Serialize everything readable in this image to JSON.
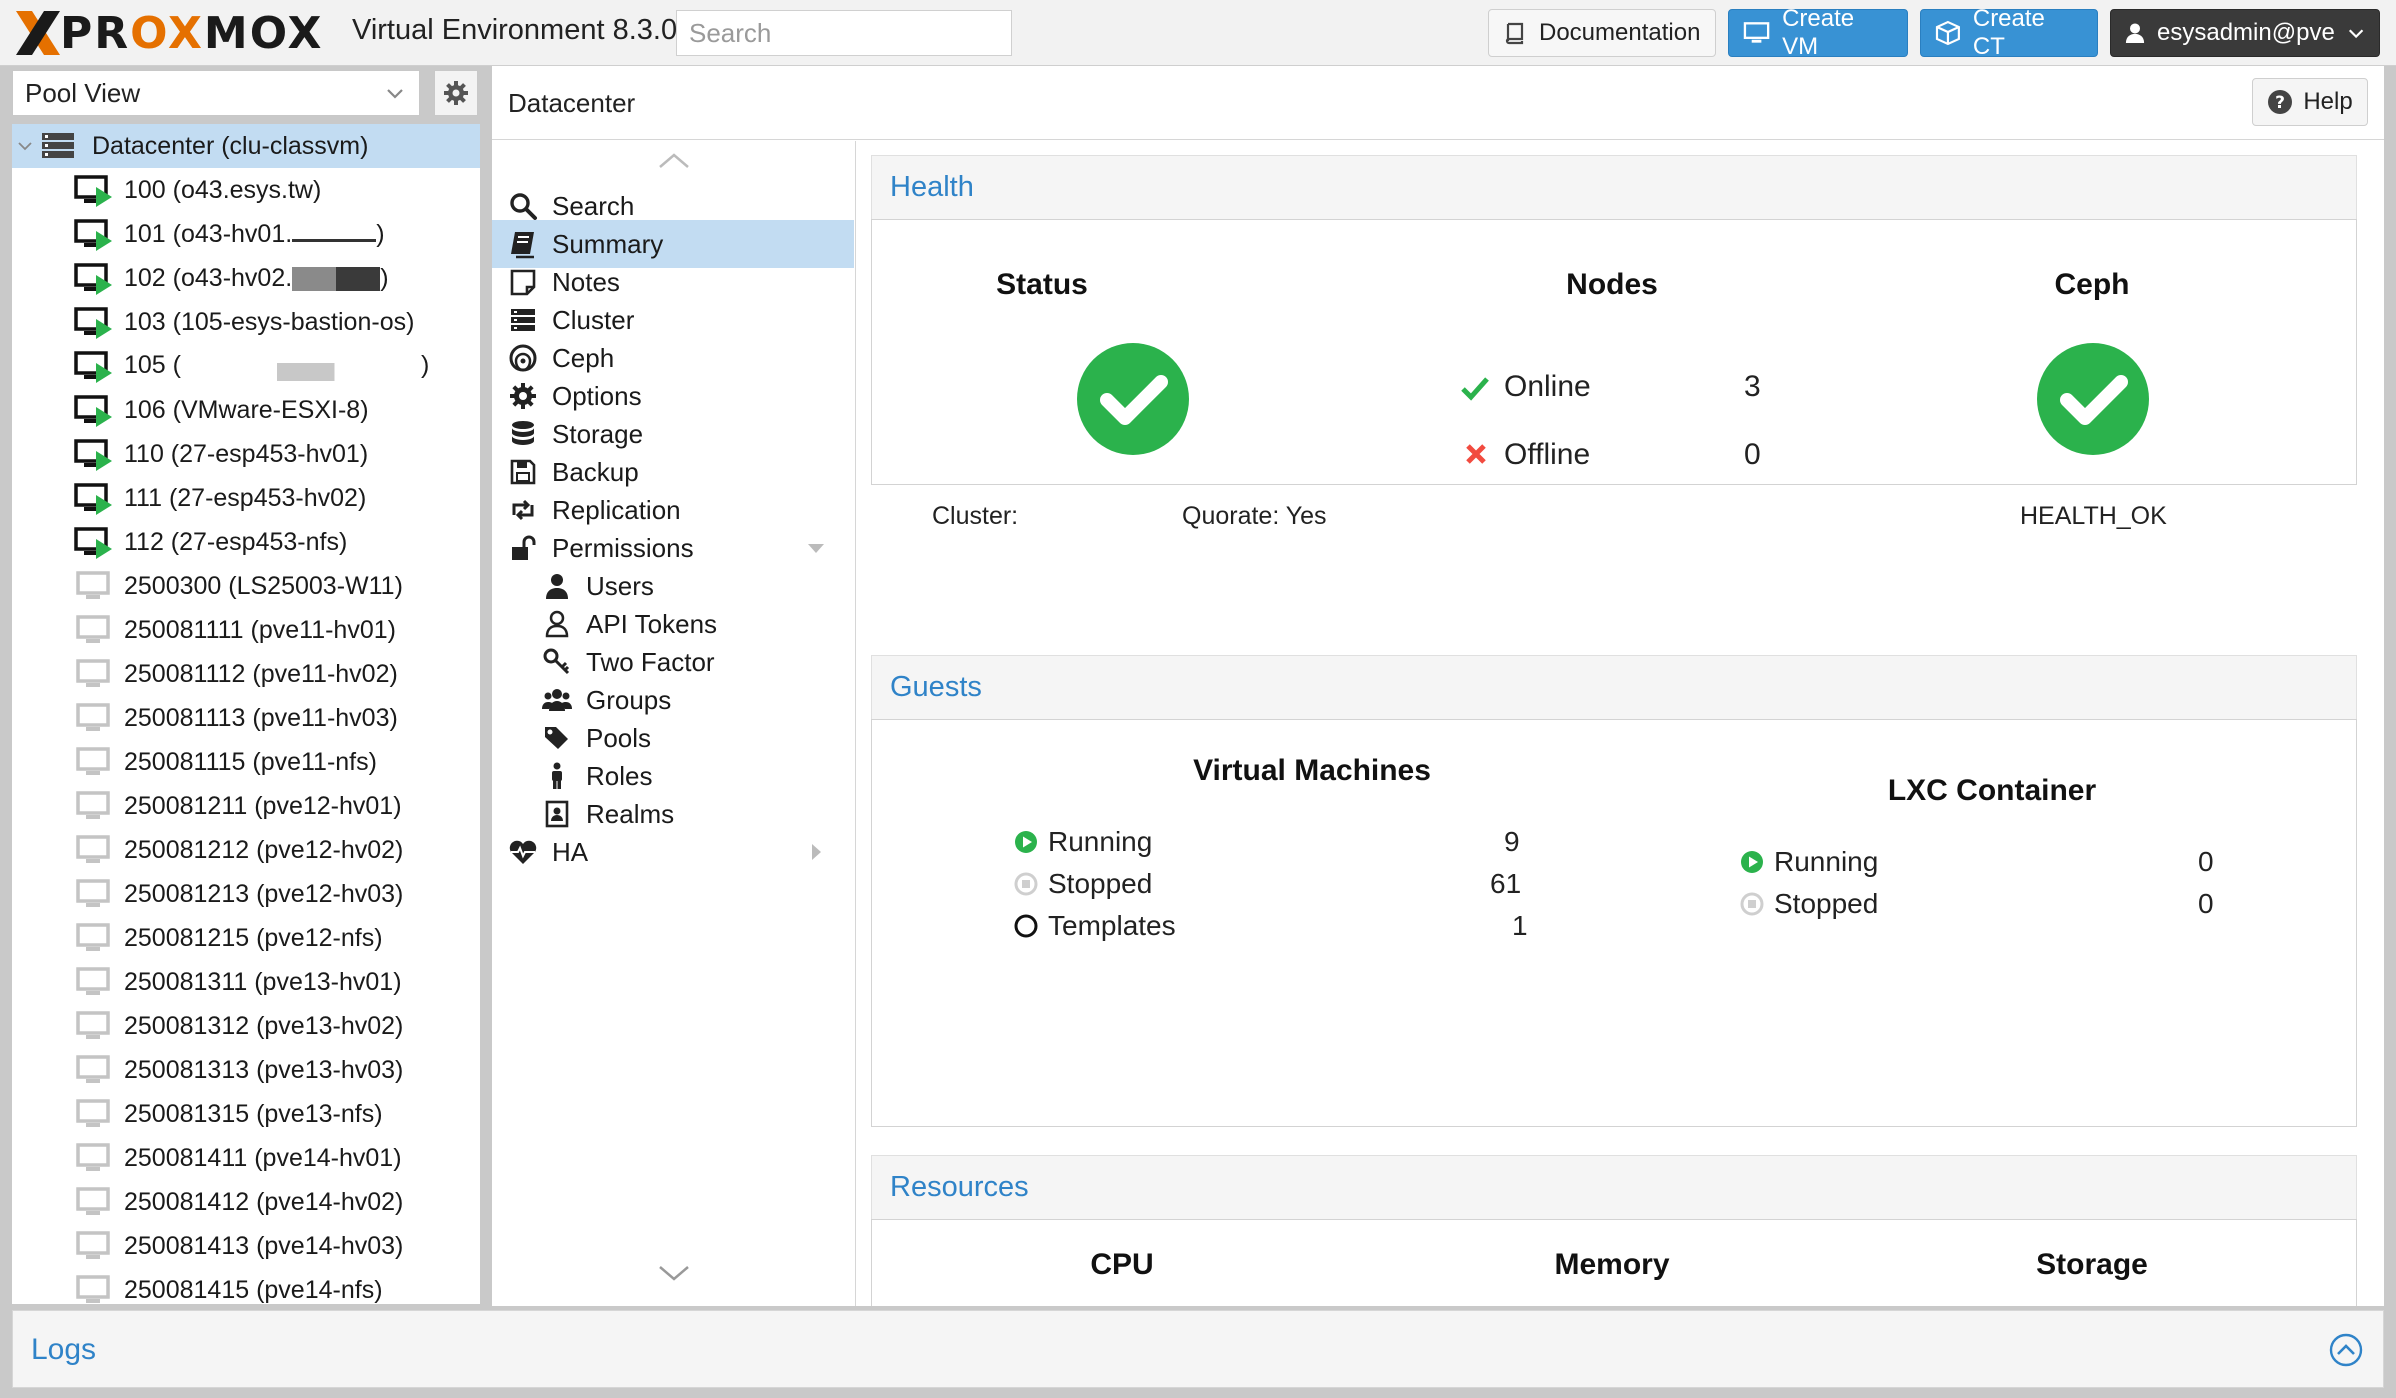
{
  "topbar": {
    "brand": "PROXMOX",
    "product": "Virtual Environment 8.3.0",
    "search_placeholder": "Search",
    "doc_label": "Documentation",
    "create_vm_label": "Create VM",
    "create_ct_label": "Create CT",
    "user_label": "esysadmin@pve",
    "accent_color": "#3892d4",
    "brand_color": "#e57000"
  },
  "tree": {
    "view_selected": "Pool View",
    "root": "Datacenter (clu-classvm)",
    "items": [
      {
        "prefix": "100 (o43.esys.tw)",
        "suffix": "",
        "running": true,
        "redact": ""
      },
      {
        "prefix": "101 (o43-hv01.",
        "suffix": ")",
        "running": true,
        "redact": "underline"
      },
      {
        "prefix": "102 (o43-hv02.",
        "suffix": ")",
        "running": true,
        "redact": "dark"
      },
      {
        "prefix": "103 (105-esys-bastion-os)",
        "suffix": "",
        "running": true,
        "redact": ""
      },
      {
        "prefix": "105 (",
        "suffix": ")",
        "running": true,
        "redact": "light"
      },
      {
        "prefix": "106 (VMware-ESXI-8)",
        "suffix": "",
        "running": true,
        "redact": ""
      },
      {
        "prefix": "110 (27-esp453-hv01)",
        "suffix": "",
        "running": true,
        "redact": ""
      },
      {
        "prefix": "111 (27-esp453-hv02)",
        "suffix": "",
        "running": true,
        "redact": ""
      },
      {
        "prefix": "112 (27-esp453-nfs)",
        "suffix": "",
        "running": true,
        "redact": ""
      },
      {
        "prefix": "2500300 (LS25003-W11)",
        "suffix": "",
        "running": false,
        "redact": ""
      },
      {
        "prefix": "250081111 (pve11-hv01)",
        "suffix": "",
        "running": false,
        "redact": ""
      },
      {
        "prefix": "250081112 (pve11-hv02)",
        "suffix": "",
        "running": false,
        "redact": ""
      },
      {
        "prefix": "250081113 (pve11-hv03)",
        "suffix": "",
        "running": false,
        "redact": ""
      },
      {
        "prefix": "250081115 (pve11-nfs)",
        "suffix": "",
        "running": false,
        "redact": ""
      },
      {
        "prefix": "250081211 (pve12-hv01)",
        "suffix": "",
        "running": false,
        "redact": ""
      },
      {
        "prefix": "250081212 (pve12-hv02)",
        "suffix": "",
        "running": false,
        "redact": ""
      },
      {
        "prefix": "250081213 (pve12-hv03)",
        "suffix": "",
        "running": false,
        "redact": ""
      },
      {
        "prefix": "250081215 (pve12-nfs)",
        "suffix": "",
        "running": false,
        "redact": ""
      },
      {
        "prefix": "250081311 (pve13-hv01)",
        "suffix": "",
        "running": false,
        "redact": ""
      },
      {
        "prefix": "250081312 (pve13-hv02)",
        "suffix": "",
        "running": false,
        "redact": ""
      },
      {
        "prefix": "250081313 (pve13-hv03)",
        "suffix": "",
        "running": false,
        "redact": ""
      },
      {
        "prefix": "250081315 (pve13-nfs)",
        "suffix": "",
        "running": false,
        "redact": ""
      },
      {
        "prefix": "250081411 (pve14-hv01)",
        "suffix": "",
        "running": false,
        "redact": ""
      },
      {
        "prefix": "250081412 (pve14-hv02)",
        "suffix": "",
        "running": false,
        "redact": ""
      },
      {
        "prefix": "250081413 (pve14-hv03)",
        "suffix": "",
        "running": false,
        "redact": ""
      },
      {
        "prefix": "250081415 (pve14-nfs)",
        "suffix": "",
        "running": false,
        "redact": ""
      }
    ]
  },
  "main": {
    "breadcrumb": "Datacenter",
    "help_label": "Help"
  },
  "nav": {
    "items": [
      {
        "label": "Search",
        "icon": "search-icon",
        "sub": false,
        "active": false,
        "caret": ""
      },
      {
        "label": "Summary",
        "icon": "book-icon",
        "sub": false,
        "active": true,
        "caret": ""
      },
      {
        "label": "Notes",
        "icon": "note-icon",
        "sub": false,
        "active": false,
        "caret": ""
      },
      {
        "label": "Cluster",
        "icon": "server-icon",
        "sub": false,
        "active": false,
        "caret": ""
      },
      {
        "label": "Ceph",
        "icon": "ceph-icon",
        "sub": false,
        "active": false,
        "caret": ""
      },
      {
        "label": "Options",
        "icon": "gear-icon",
        "sub": false,
        "active": false,
        "caret": ""
      },
      {
        "label": "Storage",
        "icon": "database-icon",
        "sub": false,
        "active": false,
        "caret": ""
      },
      {
        "label": "Backup",
        "icon": "floppy-icon",
        "sub": false,
        "active": false,
        "caret": ""
      },
      {
        "label": "Replication",
        "icon": "retweet-icon",
        "sub": false,
        "active": false,
        "caret": ""
      },
      {
        "label": "Permissions",
        "icon": "unlock-icon",
        "sub": false,
        "active": false,
        "caret": "down"
      },
      {
        "label": "Users",
        "icon": "user-icon",
        "sub": true,
        "active": false,
        "caret": ""
      },
      {
        "label": "API Tokens",
        "icon": "user-outline-icon",
        "sub": true,
        "active": false,
        "caret": ""
      },
      {
        "label": "Two Factor",
        "icon": "key-icon",
        "sub": true,
        "active": false,
        "caret": ""
      },
      {
        "label": "Groups",
        "icon": "users-icon",
        "sub": true,
        "active": false,
        "caret": ""
      },
      {
        "label": "Pools",
        "icon": "tags-icon",
        "sub": true,
        "active": false,
        "caret": ""
      },
      {
        "label": "Roles",
        "icon": "person-icon",
        "sub": true,
        "active": false,
        "caret": ""
      },
      {
        "label": "Realms",
        "icon": "address-book-icon",
        "sub": true,
        "active": false,
        "caret": ""
      },
      {
        "label": "HA",
        "icon": "heartbeat-icon",
        "sub": false,
        "active": false,
        "caret": "right"
      }
    ]
  },
  "health": {
    "title": "Health",
    "status_title": "Status",
    "cluster_label": "Cluster:",
    "quorate_label": "Quorate: Yes",
    "nodes_title": "Nodes",
    "online_label": "Online",
    "online_count": "3",
    "offline_label": "Offline",
    "offline_count": "0",
    "ceph_title": "Ceph",
    "ceph_status": "HEALTH_OK",
    "ok_color": "#2bb24c",
    "error_color": "#f24b3f"
  },
  "guests": {
    "title": "Guests",
    "vm_title": "Virtual Machines",
    "vm_running_label": "Running",
    "vm_running": "9",
    "vm_stopped_label": "Stopped",
    "vm_stopped": "61",
    "vm_templates_label": "Templates",
    "vm_templates": "1",
    "lxc_title": "LXC Container",
    "lxc_running_label": "Running",
    "lxc_running": "0",
    "lxc_stopped_label": "Stopped",
    "lxc_stopped": "0"
  },
  "resources": {
    "title": "Resources",
    "cpu_label": "CPU",
    "memory_label": "Memory",
    "storage_label": "Storage"
  },
  "logs": {
    "title": "Logs"
  }
}
